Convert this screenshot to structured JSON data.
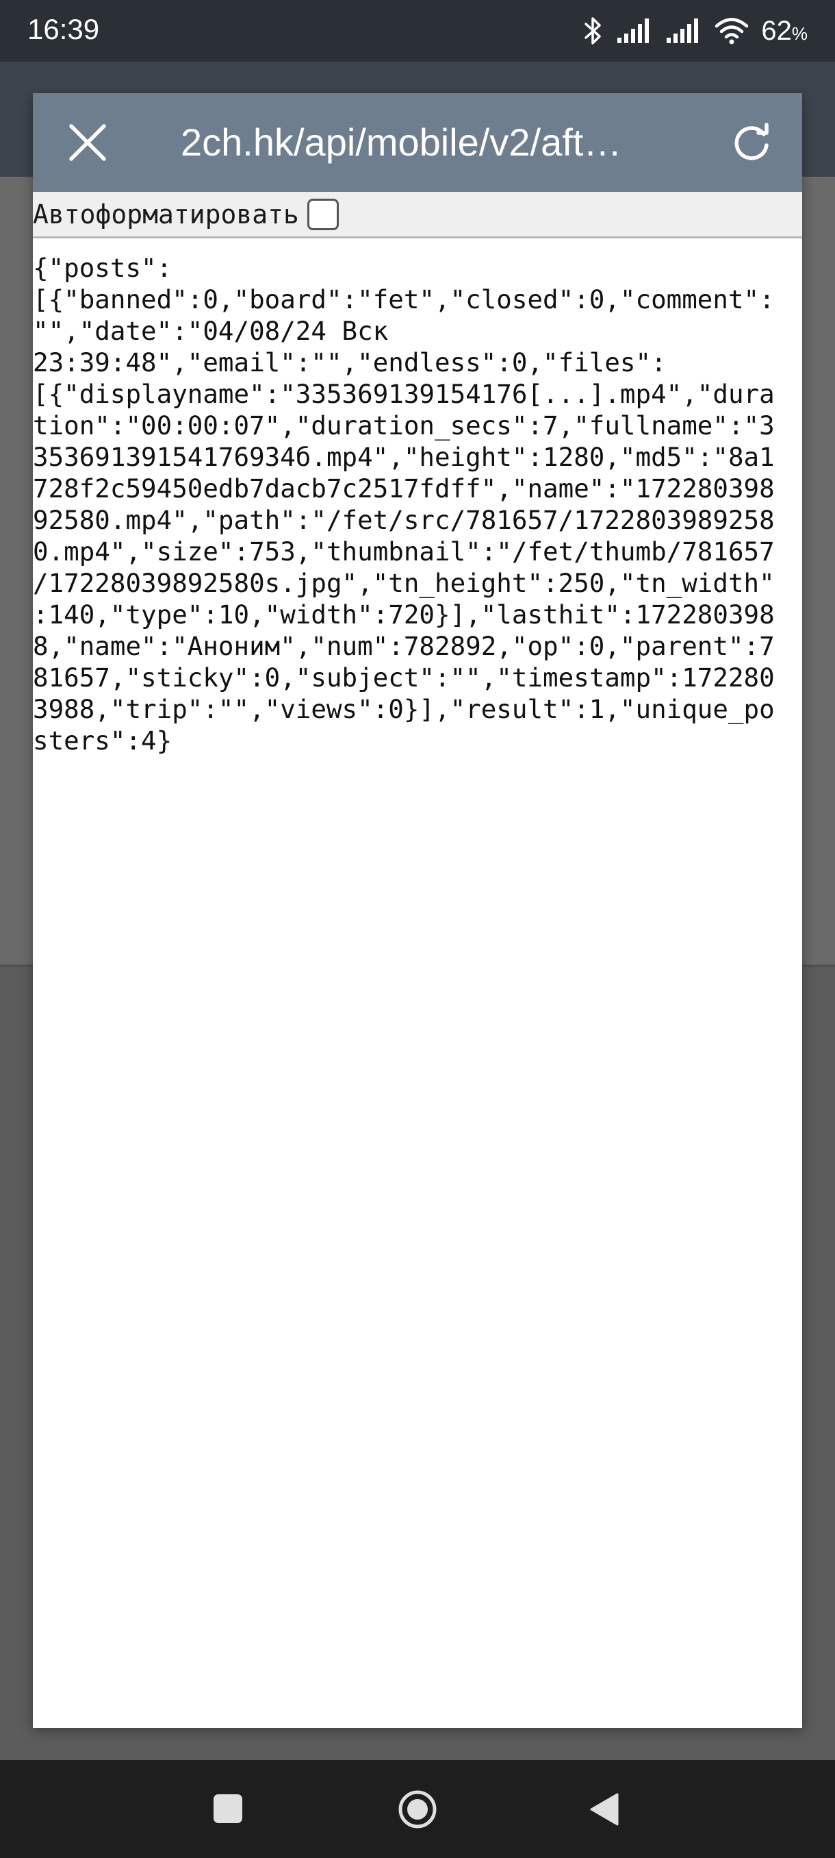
{
  "status_bar": {
    "time": "16:39",
    "battery": "62",
    "battery_unit": "%",
    "icons": [
      "bluetooth-icon",
      "signal-icon",
      "signal-icon",
      "wifi-icon"
    ]
  },
  "dialog": {
    "title": "2ch.hk/api/mobile/v2/aft…",
    "autoformat_label": "Автоформатировать",
    "autoformat_checked": false,
    "json_lines": [
      "{\"posts\":",
      "[{\"banned\":0,\"board\":\"fet\",\"closed\":0,\"comment\":",
      "\"\",\"date\":\"04/08/24 Вск",
      "23:39:48\",\"email\":\"\",\"endless\":0,\"files\":",
      "[{\"displayname\":\"335369139154176[...].mp4\",\"dura",
      "tion\":\"00:00:07\",\"duration_secs\":7,\"fullname\":\"3",
      "35369139154176934б.mp4\",\"height\":1280,\"md5\":\"8a1",
      "728f2c59450edb7dacb7c2517fdff\",\"name\":\"172280398",
      "92580.mp4\",\"path\":\"/fet/src/781657/1722803989258",
      "0.mp4\",\"size\":753,\"thumbnail\":\"/fet/thumb/781657",
      "/17228039892580s.jpg\",\"tn_height\":250,\"tn_width\"",
      ":140,\"type\":10,\"width\":720}],\"lasthit\":172280398",
      "8,\"name\":\"Аноним\",\"num\":782892,\"op\":0,\"parent\":7",
      "81657,\"sticky\":0,\"subject\":\"\",\"timestamp\":172280",
      "3988,\"trip\":\"\",\"views\":0}],\"result\":1,\"unique_po",
      "sters\":4}"
    ]
  },
  "nav_bar": {
    "buttons": [
      "recents-button",
      "home-button",
      "back-button"
    ]
  }
}
